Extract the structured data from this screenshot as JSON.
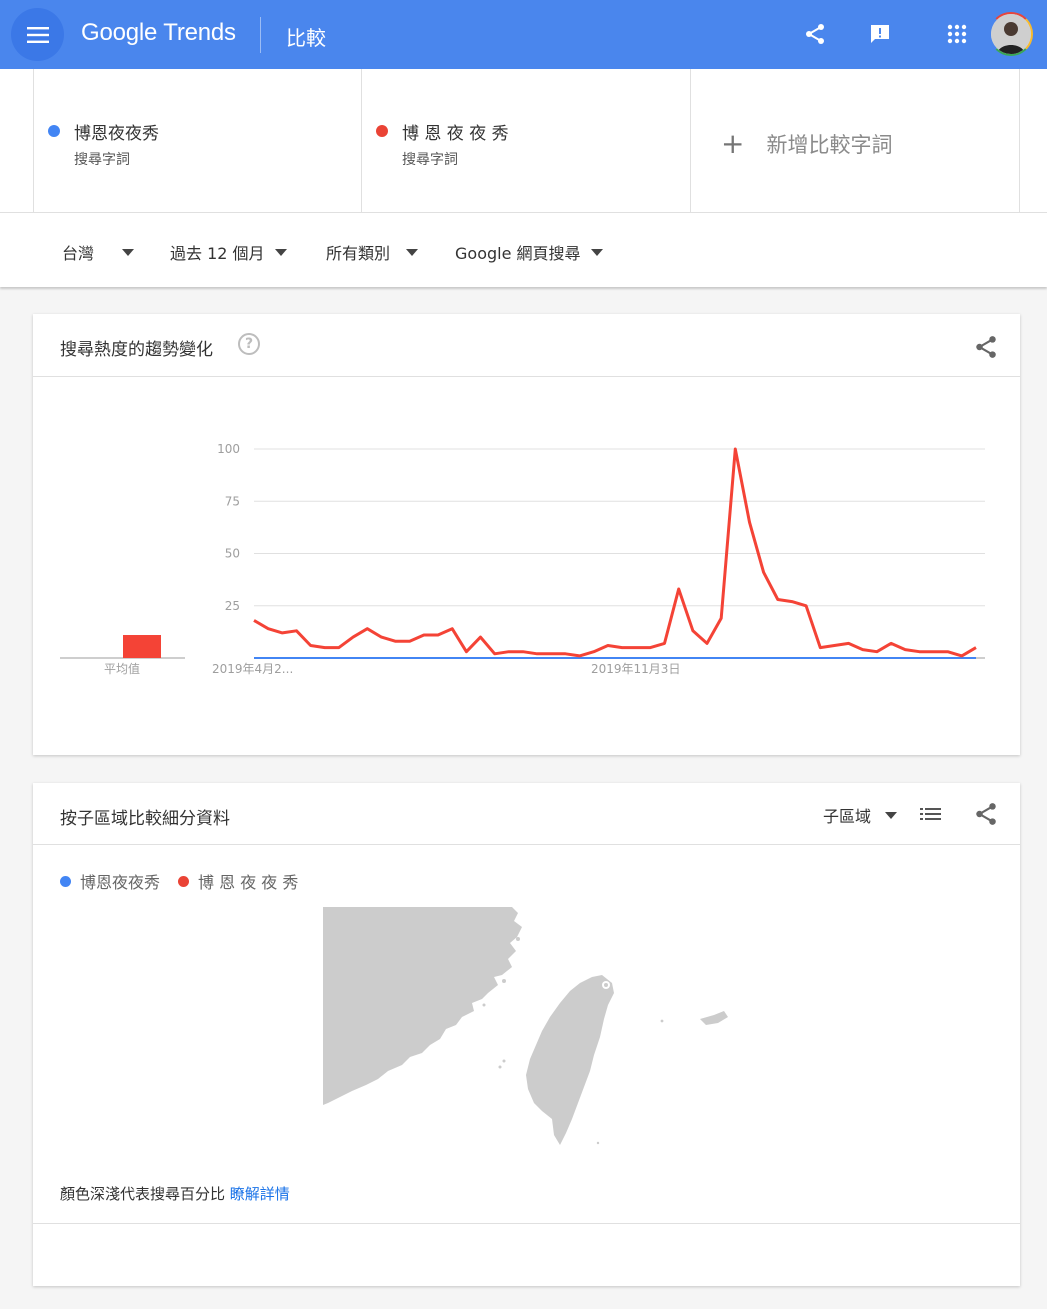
{
  "header": {
    "logo_google": "Google",
    "logo_trends": "Trends",
    "title": "比較",
    "icons": [
      "menu-icon",
      "share-icon",
      "feedback-icon",
      "apps-icon"
    ]
  },
  "terms": [
    {
      "name": "博恩夜夜秀",
      "type": "搜尋字詞",
      "color": "#4285f4"
    },
    {
      "name": "博 恩 夜 夜 秀",
      "type": "搜尋字詞",
      "color": "#ea4335"
    }
  ],
  "add_term_label": "新增比較字詞",
  "filters": {
    "region": "台灣",
    "time": "過去 12 個月",
    "category": "所有類別",
    "search_type": "Google 網頁搜尋"
  },
  "trend_card": {
    "title": "搜尋熱度的趨勢變化",
    "help_icon": "?",
    "avg_label": "平均值",
    "x_labels": [
      "2019年4月2...",
      "2019年11月3日"
    ],
    "y_ticks": [
      "100",
      "75",
      "50",
      "25"
    ]
  },
  "chart_data": {
    "type": "line",
    "ylim": [
      0,
      100
    ],
    "x_tick_labels": [
      "2019年4月2...",
      "2019年11月3日"
    ],
    "y_tick_labels": [
      0,
      25,
      50,
      75,
      100
    ],
    "grid": true,
    "averages": [
      {
        "series": "博恩夜夜秀",
        "value": 0
      },
      {
        "series": "博 恩 夜 夜 秀",
        "value": 11
      }
    ],
    "series": [
      {
        "name": "博恩夜夜秀",
        "color": "#4285f4",
        "values": [
          0,
          0,
          0,
          0,
          0,
          0,
          0,
          0,
          0,
          0,
          0,
          0,
          0,
          0,
          0,
          0,
          0,
          0,
          0,
          0,
          0,
          0,
          0,
          0,
          0,
          0,
          0,
          0,
          0,
          0,
          0,
          0,
          0,
          0,
          0,
          0,
          0,
          0,
          0,
          0,
          0,
          0,
          0,
          0,
          0,
          0,
          0,
          0,
          0,
          0,
          0,
          0,
          0
        ]
      },
      {
        "name": "博 恩 夜 夜 秀",
        "color": "#ea4335",
        "values": [
          18,
          14,
          12,
          13,
          6,
          5,
          5,
          10,
          14,
          10,
          8,
          8,
          11,
          11,
          14,
          3,
          10,
          2,
          3,
          3,
          2,
          2,
          2,
          1,
          3,
          6,
          5,
          5,
          5,
          7,
          33,
          13,
          7,
          19,
          100,
          65,
          41,
          28,
          27,
          25,
          5,
          6,
          7,
          4,
          3,
          7,
          4,
          3,
          3,
          3,
          1,
          5
        ]
      }
    ]
  },
  "region_card": {
    "title": "按子區域比較細分資料",
    "sub_region_label": "子區域",
    "legend": [
      "博恩夜夜秀",
      "博 恩 夜 夜 秀"
    ],
    "note_text": "顏色深淺代表搜尋百分比",
    "note_link": "瞭解詳情"
  }
}
